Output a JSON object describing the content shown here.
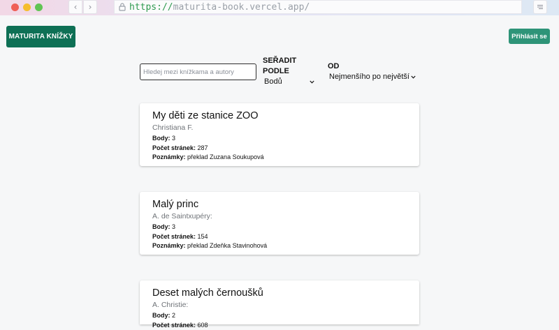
{
  "browser": {
    "url_scheme": "https://",
    "url_host": "maturita-book.vercel.app/"
  },
  "header": {
    "brand_label": "MATURITA KNÍŽKY",
    "login_label": "Přihlásit se"
  },
  "filters": {
    "search_placeholder": "Hledej mezi knížkama a autory",
    "sort_label_line1": "SEŘADIT",
    "sort_label_line2": "PODLE",
    "sort_value": "Bodů",
    "order_label": "OD",
    "order_value": "Nejmenšího po největší"
  },
  "field_labels": {
    "points": "Body:",
    "pages": "Počet stránek:",
    "notes": "Poznámky:"
  },
  "books": [
    {
      "title": "My děti ze stanice ZOO",
      "author": "Christiana F.",
      "points": "3",
      "pages": "287",
      "notes": "překlad Zuzana Soukupová"
    },
    {
      "title": "Malý princ",
      "author": "A. de Saintxupéry:",
      "points": "3",
      "pages": "154",
      "notes": "překlad Zdeňka Stavinohová"
    },
    {
      "title": "Deset malých černoušků",
      "author": "A. Christie:",
      "points": "2",
      "pages": "608",
      "notes": ""
    }
  ]
}
